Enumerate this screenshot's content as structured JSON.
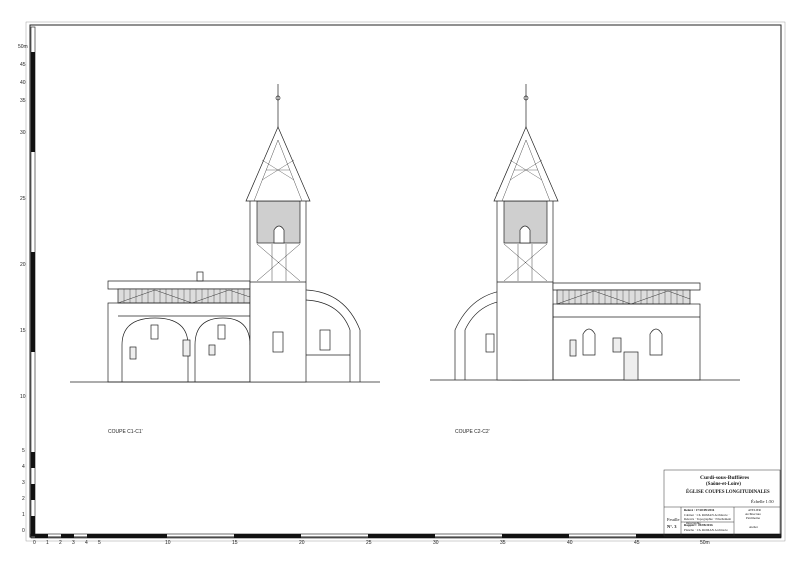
{
  "scale_bar": {
    "bottom_ticks": [
      "0",
      "1",
      "2",
      "3",
      "4",
      "5",
      "10",
      "15",
      "20",
      "25",
      "30",
      "35",
      "40",
      "45",
      "50m"
    ],
    "left_ticks": [
      "0",
      "1",
      "2",
      "3",
      "4",
      "5",
      "10",
      "15",
      "20",
      "25",
      "30",
      "35",
      "40",
      "45",
      "50m"
    ]
  },
  "sections": {
    "left_caption": "COUPE C1-C1'",
    "right_caption": "COUPE C2-C2'"
  },
  "title_block": {
    "town": "Curdi-sous-Buffières",
    "department": "(Saône-et-Loire)",
    "drawing_title": "ÉGLISE   COUPES LONGITUDINALES",
    "scale": "Échelle 1:50",
    "survey_date": "Relevé : 17/20/09/2016",
    "survey_detail": "Cabinet · Ch. ROMAN Architecte · Relevés · Topographie · Nivellement · Infographie",
    "report_date": "Rapport : 09/08/2016",
    "report_detail": "Planche · Ch. ROMAN Architecte",
    "sheet_label": "Feuille",
    "sheet_number": "N°. 3",
    "stamp_lines": [
      "ATELIER",
      "Architecture",
      "Patrimoine"
    ],
    "side_note": "Atelier"
  }
}
